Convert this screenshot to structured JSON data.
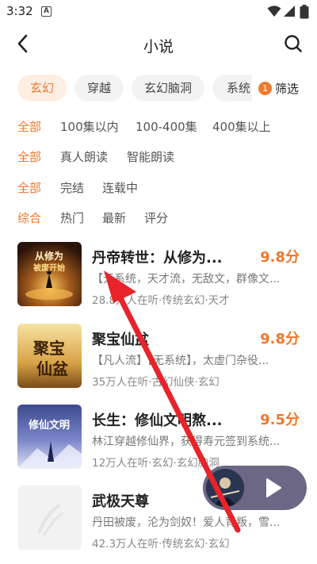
{
  "status_bar": {
    "time": "3:32",
    "app_icon_letter": "A"
  },
  "header": {
    "title": "小说",
    "back_icon": "back-arrow-icon",
    "search_icon": "search-icon"
  },
  "category_tabs": [
    {
      "label": "玄幻",
      "active": true
    },
    {
      "label": "穿越",
      "active": false
    },
    {
      "label": "玄幻脑洞",
      "active": false
    },
    {
      "label": "系统",
      "active": false
    }
  ],
  "filter_button": {
    "badge": "1",
    "label": "筛选"
  },
  "filters": {
    "length": [
      "全部",
      "100集以内",
      "100-400集",
      "400集以上"
    ],
    "voice": [
      "全部",
      "真人朗读",
      "智能朗读"
    ],
    "status": [
      "全部",
      "完结",
      "连载中"
    ],
    "sort": [
      "综合",
      "热门",
      "最新",
      "评分"
    ]
  },
  "books": [
    {
      "title": "丹帝转世：从修为...",
      "score": "9.8分",
      "desc": "【无系统，天才流，无敌文，群像文...",
      "meta": "28.8万人在听·传统玄幻·天才"
    },
    {
      "title": "聚宝仙盆",
      "score": "9.8分",
      "desc": "【凡人流】【无系统】，太虚门杂役...",
      "meta": "35万人在听·古幻仙侠·玄幻"
    },
    {
      "title": "长生：修仙文明熬...",
      "score": "9.5分",
      "desc": "林江穿越修仙界，获得寿元签到系统...",
      "meta": "12万人在听·玄幻·玄幻脑洞"
    },
    {
      "title": "武极天尊",
      "score": "",
      "desc": "丹田被废，沦为剑奴！爱人背叛，雪...",
      "meta": "42.3万人在听·传统玄幻·玄幻"
    }
  ],
  "covers": {
    "1": {
      "line1": "从修为",
      "line2": "被废开始"
    },
    "2": {
      "line1": "聚宝",
      "line2": "仙盆"
    },
    "3": {
      "line1": "修仙文明"
    }
  },
  "mini_player": {
    "play_icon": "play-icon"
  },
  "colors": {
    "accent": "#f0782a",
    "annotation_arrow": "#e8232a",
    "player_bg": "#6b6784"
  }
}
